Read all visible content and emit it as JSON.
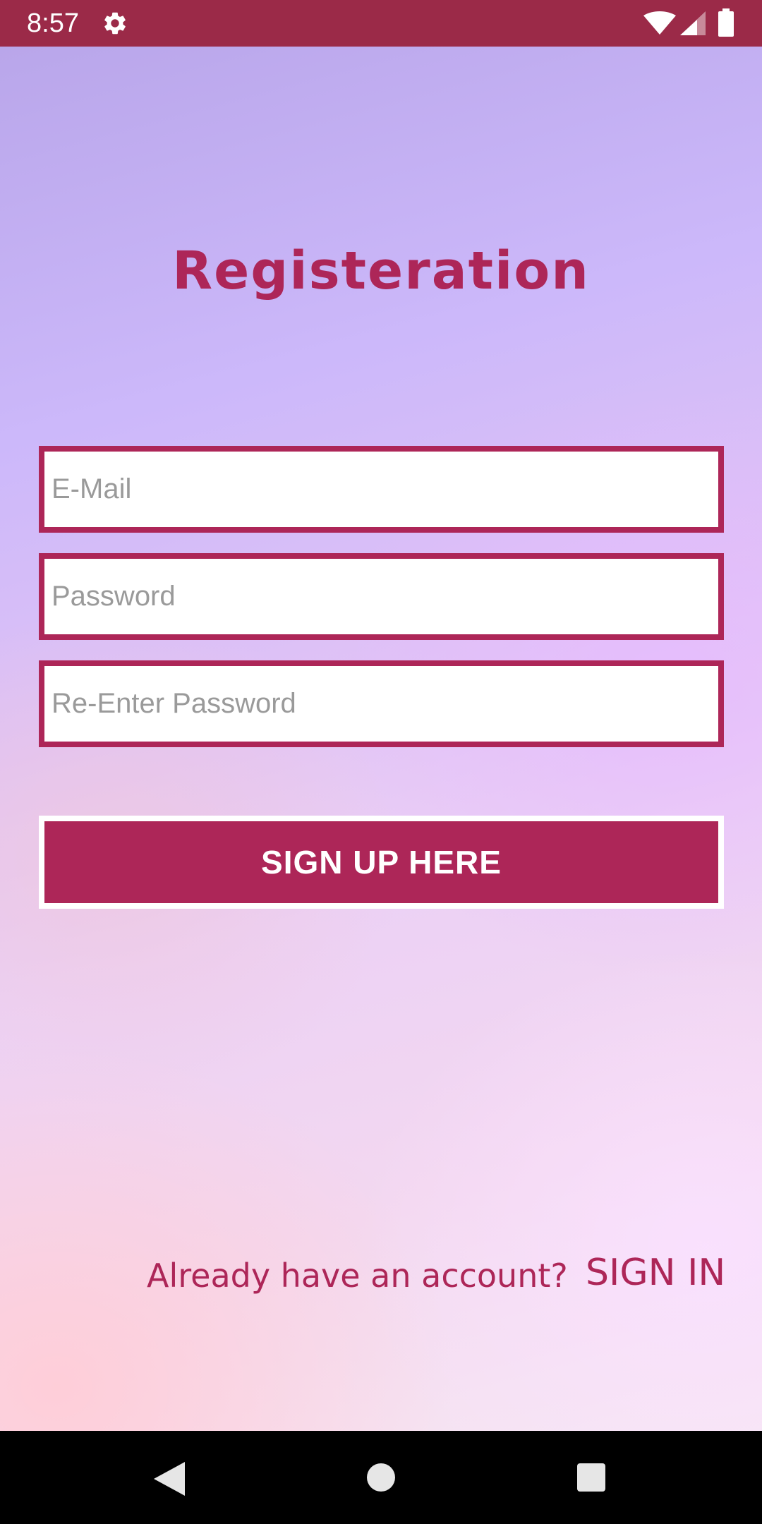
{
  "status_bar": {
    "time": "8:57",
    "icons": [
      "gear-icon",
      "wifi-icon",
      "cellular-signal-icon",
      "battery-icon"
    ]
  },
  "page": {
    "title": "Registeration"
  },
  "form": {
    "email": {
      "placeholder": "E-Mail",
      "value": ""
    },
    "password": {
      "placeholder": "Password",
      "value": ""
    },
    "repassword": {
      "placeholder": "Re-Enter Password",
      "value": ""
    },
    "signup_label": "SIGN UP HERE"
  },
  "footer": {
    "already_text": "Already have an account?",
    "signin_label": "SIGN IN"
  },
  "nav_bar": {
    "icons": [
      "back-icon",
      "home-icon",
      "recents-icon"
    ]
  },
  "colors": {
    "accent": "#ad2658",
    "status_bar": "#9b2a48",
    "field_background": "#ffffff",
    "placeholder": "#9a9a9a"
  }
}
